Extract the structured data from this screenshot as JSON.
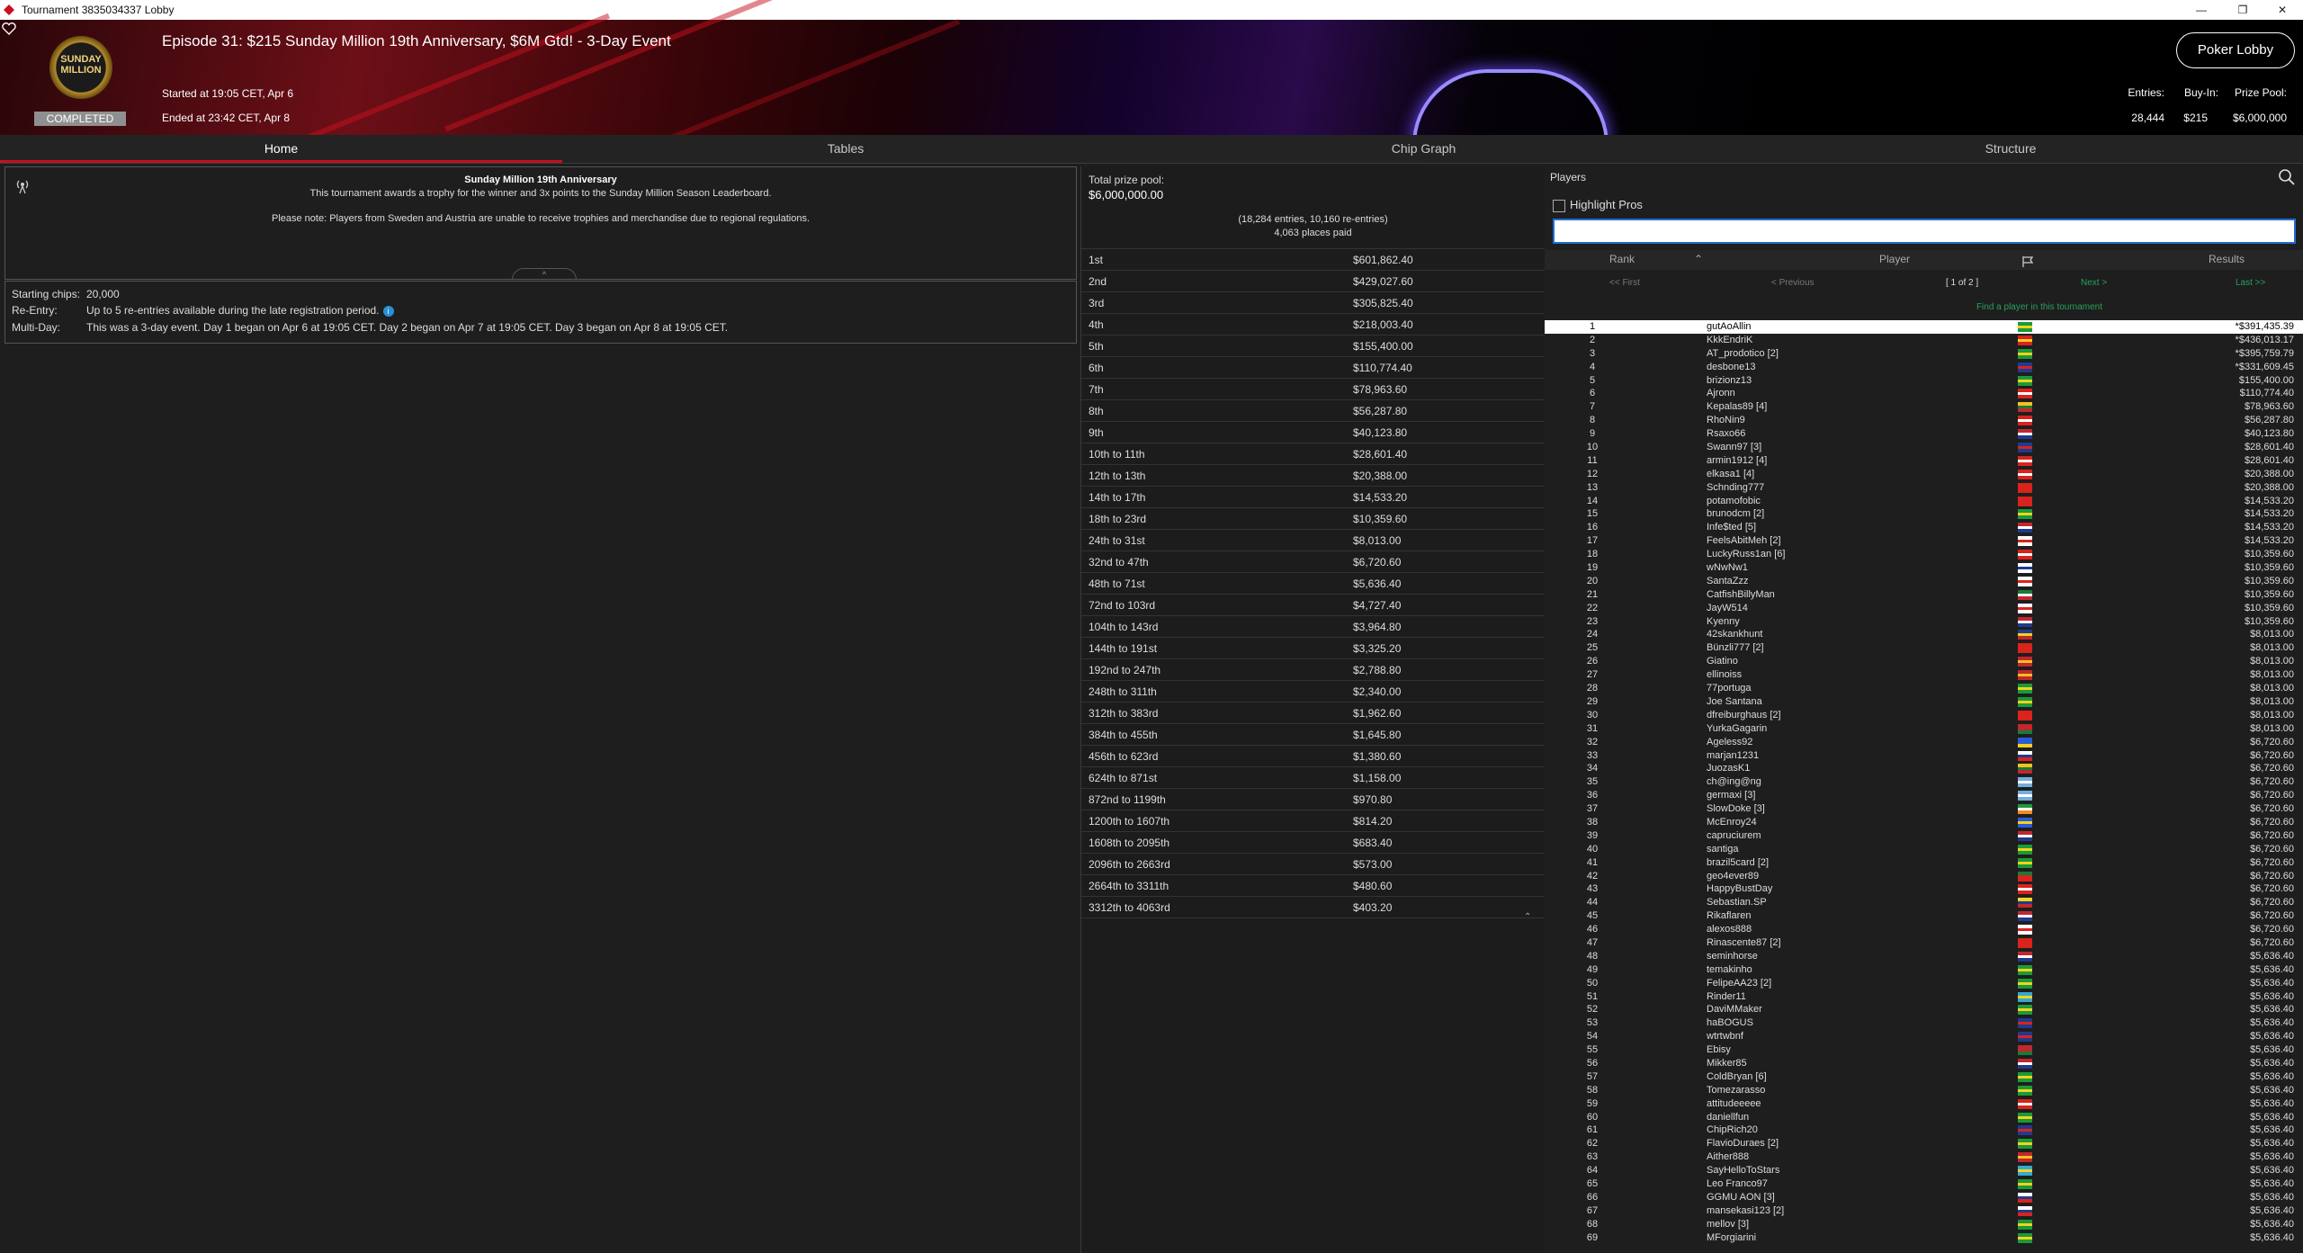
{
  "window": {
    "title": "Tournament 3835034337 Lobby"
  },
  "header": {
    "logo_text": "SUNDAY MILLION",
    "status": "COMPLETED",
    "event_title": "Episode 31: $215 Sunday Million 19th Anniversary, $6M Gtd! - 3-Day Event",
    "started": "Started at 19:05 CET, Apr 6",
    "ended": "Ended at 23:42 CET, Apr 8",
    "poker_lobby_label": "Poker Lobby",
    "entries_label": "Entries:",
    "entries_value": "28,444",
    "buyin_label": "Buy-In:",
    "buyin_value": "$215",
    "prizepool_label": "Prize Pool:",
    "prizepool_value": "$6,000,000"
  },
  "tabs": [
    {
      "label": "Home"
    },
    {
      "label": "Tables"
    },
    {
      "label": "Chip Graph"
    },
    {
      "label": "Structure"
    }
  ],
  "info": {
    "title": "Sunday Million 19th Anniversary",
    "line1": "This tournament awards a trophy for the winner and 3x points to the Sunday Million Season Leaderboard.",
    "line2": "Please note: Players from Sweden and Austria are unable to receive trophies and merchandise due to regional regulations."
  },
  "details": {
    "starting_chips_label": "Starting chips:",
    "starting_chips_value": "20,000",
    "reentry_label": "Re-Entry:",
    "reentry_value": "Up to 5 re-entries available during the late registration period.",
    "multiday_label": "Multi-Day:",
    "multiday_value": "This was a 3-day event. Day 1 began on Apr 6 at 19:05 CET. Day 2 began on Apr 7 at 19:05 CET. Day 3 began on Apr 8 at 19:05 CET."
  },
  "prizes": {
    "total_label": "Total prize pool:",
    "total_value": "$6,000,000.00",
    "entries_text": "(18,284 entries, 10,160 re-entries)",
    "paid_text": "4,063 places paid",
    "rows": [
      {
        "place": "1st",
        "amount": "$601,862.40"
      },
      {
        "place": "2nd",
        "amount": "$429,027.60"
      },
      {
        "place": "3rd",
        "amount": "$305,825.40"
      },
      {
        "place": "4th",
        "amount": "$218,003.40"
      },
      {
        "place": "5th",
        "amount": "$155,400.00"
      },
      {
        "place": "6th",
        "amount": "$110,774.40"
      },
      {
        "place": "7th",
        "amount": "$78,963.60"
      },
      {
        "place": "8th",
        "amount": "$56,287.80"
      },
      {
        "place": "9th",
        "amount": "$40,123.80"
      },
      {
        "place": "10th to 11th",
        "amount": "$28,601.40"
      },
      {
        "place": "12th to 13th",
        "amount": "$20,388.00"
      },
      {
        "place": "14th to 17th",
        "amount": "$14,533.20"
      },
      {
        "place": "18th to 23rd",
        "amount": "$10,359.60"
      },
      {
        "place": "24th to 31st",
        "amount": "$8,013.00"
      },
      {
        "place": "32nd to 47th",
        "amount": "$6,720.60"
      },
      {
        "place": "48th to 71st",
        "amount": "$5,636.40"
      },
      {
        "place": "72nd to 103rd",
        "amount": "$4,727.40"
      },
      {
        "place": "104th to 143rd",
        "amount": "$3,964.80"
      },
      {
        "place": "144th to 191st",
        "amount": "$3,325.20"
      },
      {
        "place": "192nd to 247th",
        "amount": "$2,788.80"
      },
      {
        "place": "248th to 311th",
        "amount": "$2,340.00"
      },
      {
        "place": "312th to 383rd",
        "amount": "$1,962.60"
      },
      {
        "place": "384th to 455th",
        "amount": "$1,645.80"
      },
      {
        "place": "456th to 623rd",
        "amount": "$1,380.60"
      },
      {
        "place": "624th to 871st",
        "amount": "$1,158.00"
      },
      {
        "place": "872nd to 1199th",
        "amount": "$970.80"
      },
      {
        "place": "1200th to 1607th",
        "amount": "$814.20"
      },
      {
        "place": "1608th to 2095th",
        "amount": "$683.40"
      },
      {
        "place": "2096th to 2663rd",
        "amount": "$573.00"
      },
      {
        "place": "2664th to 3311th",
        "amount": "$480.60"
      },
      {
        "place": "3312th to 4063rd",
        "amount": "$403.20"
      }
    ]
  },
  "players": {
    "title": "Players",
    "highlight_pros": "Highlight Pros",
    "search_placeholder": "",
    "col_rank": "Rank",
    "col_player": "Player",
    "col_results": "Results",
    "first": "<< First",
    "previous": "< Previous",
    "page": "[ 1 of 2 ]",
    "next": "Next >",
    "last": "Last >>",
    "find": "Find a player in this tournament",
    "rows": [
      {
        "rank": "1",
        "name": "gutAoAllin",
        "flag": "brazil",
        "result": "*$391,435.39"
      },
      {
        "rank": "2",
        "name": "KkkEndriK",
        "flag": "vietnam",
        "result": "*$436,013.17"
      },
      {
        "rank": "3",
        "name": "AT_prodotico [2]",
        "flag": "brazil",
        "result": "*$395,759.79"
      },
      {
        "rank": "4",
        "name": "desbone13",
        "flag": "uk",
        "result": "*$331,609.45"
      },
      {
        "rank": "5",
        "name": "brizionz13",
        "flag": "brazil",
        "result": "$155,400.00"
      },
      {
        "rank": "6",
        "name": "Ajronn",
        "flag": "austria",
        "result": "$110,774.40"
      },
      {
        "rank": "7",
        "name": "Kepalas89 [4]",
        "flag": "lithuania",
        "result": "$78,963.60"
      },
      {
        "rank": "8",
        "name": "RhoNin9",
        "flag": "austria",
        "result": "$56,287.80"
      },
      {
        "rank": "9",
        "name": "Rsaxo66",
        "flag": "netherlands",
        "result": "$40,123.80"
      },
      {
        "rank": "10",
        "name": "Swann97 [3]",
        "flag": "uk",
        "result": "$28,601.40"
      },
      {
        "rank": "11",
        "name": "armin1912 [4]",
        "flag": "austria",
        "result": "$28,601.40"
      },
      {
        "rank": "12",
        "name": "elkasa1 [4]",
        "flag": "peru",
        "result": "$20,388.00"
      },
      {
        "rank": "13",
        "name": "Schnding777",
        "flag": "swiss",
        "result": "$20,388.00"
      },
      {
        "rank": "14",
        "name": "potamofobic",
        "flag": "swiss",
        "result": "$14,533.20"
      },
      {
        "rank": "15",
        "name": "brunodcm [2]",
        "flag": "brazil",
        "result": "$14,533.20"
      },
      {
        "rank": "16",
        "name": "Infe$ted [5]",
        "flag": "netherlands",
        "result": "$14,533.20"
      },
      {
        "rank": "17",
        "name": "FeelsAbitMeh [2]",
        "flag": "canada",
        "result": "$14,533.20"
      },
      {
        "rank": "18",
        "name": "LuckyRuss1an [6]",
        "flag": "austria",
        "result": "$10,359.60"
      },
      {
        "rank": "19",
        "name": "wNwNw1",
        "flag": "finland",
        "result": "$10,359.60"
      },
      {
        "rank": "20",
        "name": "SantaZzz",
        "flag": "canada",
        "result": "$10,359.60"
      },
      {
        "rank": "21",
        "name": "CatfishBillyMan",
        "flag": "mexico",
        "result": "$10,359.60"
      },
      {
        "rank": "22",
        "name": "JayW514",
        "flag": "canada",
        "result": "$10,359.60"
      },
      {
        "rank": "23",
        "name": "Kyenny",
        "flag": "netherlands",
        "result": "$10,359.60"
      },
      {
        "rank": "24",
        "name": "42skankhunt",
        "flag": "romania",
        "result": "$8,013.00"
      },
      {
        "rank": "25",
        "name": "Bünzli777 [2]",
        "flag": "swiss",
        "result": "$8,013.00"
      },
      {
        "rank": "26",
        "name": "Giatino",
        "flag": "spain",
        "result": "$8,013.00"
      },
      {
        "rank": "27",
        "name": "ellinoiss",
        "flag": "spain",
        "result": "$8,013.00"
      },
      {
        "rank": "28",
        "name": "77portuga",
        "flag": "brazil",
        "result": "$8,013.00"
      },
      {
        "rank": "29",
        "name": "Joe Santana",
        "flag": "brazil",
        "result": "$8,013.00"
      },
      {
        "rank": "30",
        "name": "dfreiburghaus [2]",
        "flag": "swiss",
        "result": "$8,013.00"
      },
      {
        "rank": "31",
        "name": "YurkaGagarin",
        "flag": "belarus",
        "result": "$8,013.00"
      },
      {
        "rank": "32",
        "name": "Ageless92",
        "flag": "ukraine",
        "result": "$6,720.60"
      },
      {
        "rank": "33",
        "name": "marjan1231",
        "flag": "slovenia",
        "result": "$6,720.60"
      },
      {
        "rank": "34",
        "name": "JuozasK1",
        "flag": "lithuania",
        "result": "$6,720.60"
      },
      {
        "rank": "35",
        "name": "ch@ing@ng",
        "flag": "argentina",
        "result": "$6,720.60"
      },
      {
        "rank": "36",
        "name": "germaxi [3]",
        "flag": "argentina",
        "result": "$6,720.60"
      },
      {
        "rank": "37",
        "name": "SlowDoke [3]",
        "flag": "ireland",
        "result": "$6,720.60"
      },
      {
        "rank": "38",
        "name": "McEnroy24",
        "flag": "sweden",
        "result": "$6,720.60"
      },
      {
        "rank": "39",
        "name": "capruciurem",
        "flag": "netherlands",
        "result": "$6,720.60"
      },
      {
        "rank": "40",
        "name": "santiga",
        "flag": "brazil",
        "result": "$6,720.60"
      },
      {
        "rank": "41",
        "name": "brazil5card [2]",
        "flag": "brazil",
        "result": "$6,720.60"
      },
      {
        "rank": "42",
        "name": "geo4ever89",
        "flag": "portugal",
        "result": "$6,720.60"
      },
      {
        "rank": "43",
        "name": "HappyBustDay",
        "flag": "peru",
        "result": "$6,720.60"
      },
      {
        "rank": "44",
        "name": "Sebastian.SP",
        "flag": "colombia",
        "result": "$6,720.60"
      },
      {
        "rank": "45",
        "name": "Rikaflaren",
        "flag": "netherlands",
        "result": "$6,720.60"
      },
      {
        "rank": "46",
        "name": "alexos888",
        "flag": "canada",
        "result": "$6,720.60"
      },
      {
        "rank": "47",
        "name": "Rinascente87 [2]",
        "flag": "swiss",
        "result": "$6,720.60"
      },
      {
        "rank": "48",
        "name": "seminhorse",
        "flag": "netherlands",
        "result": "$5,636.40"
      },
      {
        "rank": "49",
        "name": "temakinho",
        "flag": "brazil",
        "result": "$5,636.40"
      },
      {
        "rank": "50",
        "name": "FelipeAA23 [2]",
        "flag": "brazil",
        "result": "$5,636.40"
      },
      {
        "rank": "51",
        "name": "Rinder11",
        "flag": "kazakhstan",
        "result": "$5,636.40"
      },
      {
        "rank": "52",
        "name": "DaviMMaker",
        "flag": "brazil",
        "result": "$5,636.40"
      },
      {
        "rank": "53",
        "name": "haBOGUS",
        "flag": "uk",
        "result": "$5,636.40"
      },
      {
        "rank": "54",
        "name": "wtrtwbnf",
        "flag": "uk",
        "result": "$5,636.40"
      },
      {
        "rank": "55",
        "name": "Ebisy",
        "flag": "belarus",
        "result": "$5,636.40"
      },
      {
        "rank": "56",
        "name": "Mikker85",
        "flag": "netherlands",
        "result": "$5,636.40"
      },
      {
        "rank": "57",
        "name": "ColdBryan [6]",
        "flag": "brazil",
        "result": "$5,636.40"
      },
      {
        "rank": "58",
        "name": "Tomezarasso",
        "flag": "brazil",
        "result": "$5,636.40"
      },
      {
        "rank": "59",
        "name": "attitudeeeee",
        "flag": "austria",
        "result": "$5,636.40"
      },
      {
        "rank": "60",
        "name": "daniellfun",
        "flag": "brazil",
        "result": "$5,636.40"
      },
      {
        "rank": "61",
        "name": "ChipRich20",
        "flag": "uk",
        "result": "$5,636.40"
      },
      {
        "rank": "62",
        "name": "FlavioDuraes [2]",
        "flag": "brazil",
        "result": "$5,636.40"
      },
      {
        "rank": "63",
        "name": "Aither888",
        "flag": "spain",
        "result": "$5,636.40"
      },
      {
        "rank": "64",
        "name": "SayHelloToStars",
        "flag": "kazakhstan",
        "result": "$5,636.40"
      },
      {
        "rank": "65",
        "name": "Leo Franco97",
        "flag": "brazil",
        "result": "$5,636.40"
      },
      {
        "rank": "66",
        "name": "GGMU AON [3]",
        "flag": "slovakia",
        "result": "$5,636.40"
      },
      {
        "rank": "67",
        "name": "mansekasi123 [2]",
        "flag": "slovenia",
        "result": "$5,636.40"
      },
      {
        "rank": "68",
        "name": "mellov [3]",
        "flag": "brazil",
        "result": "$5,636.40"
      },
      {
        "rank": "69",
        "name": "MForgiarini",
        "flag": "brazil",
        "result": "$5,636.40"
      }
    ]
  },
  "flag_colors": {
    "brazil": [
      "#1a9a3a",
      "#f4d21c",
      "#1a9a3a"
    ],
    "vietnam": [
      "#d9231c",
      "#f4d21c",
      "#d9231c"
    ],
    "uk": [
      "#1f3a8f",
      "#d9231c",
      "#1f3a8f"
    ],
    "austria": [
      "#d9231c",
      "#ffffff",
      "#d9231c"
    ],
    "lithuania": [
      "#f4c21c",
      "#1a7a3a",
      "#c1272d"
    ],
    "netherlands": [
      "#c1272d",
      "#ffffff",
      "#1f3a8f"
    ],
    "peru": [
      "#d9231c",
      "#ffffff",
      "#d9231c"
    ],
    "swiss": [
      "#d9231c",
      "#d9231c",
      "#d9231c"
    ],
    "canada": [
      "#ffffff",
      "#d9231c",
      "#ffffff"
    ],
    "finland": [
      "#ffffff",
      "#1f3a8f",
      "#ffffff"
    ],
    "mexico": [
      "#1a7a3a",
      "#ffffff",
      "#c1272d"
    ],
    "romania": [
      "#1f3a8f",
      "#f4d21c",
      "#c1272d"
    ],
    "spain": [
      "#c1272d",
      "#f4c21c",
      "#c1272d"
    ],
    "belarus": [
      "#c1272d",
      "#c1272d",
      "#1a7a3a"
    ],
    "ukraine": [
      "#2a5bd7",
      "#2a5bd7",
      "#f4d21c"
    ],
    "slovenia": [
      "#ffffff",
      "#1f3a8f",
      "#d9231c"
    ],
    "argentina": [
      "#74acdf",
      "#ffffff",
      "#74acdf"
    ],
    "ireland": [
      "#1a9a3a",
      "#ffffff",
      "#f08c1c"
    ],
    "sweden": [
      "#2a5bd7",
      "#f4d21c",
      "#2a5bd7"
    ],
    "portugal": [
      "#1a7a3a",
      "#d9231c",
      "#d9231c"
    ],
    "colombia": [
      "#f4d21c",
      "#1f3a8f",
      "#c1272d"
    ],
    "kazakhstan": [
      "#35a8d0",
      "#f4d21c",
      "#35a8d0"
    ],
    "slovakia": [
      "#ffffff",
      "#1f3a8f",
      "#d9231c"
    ]
  }
}
